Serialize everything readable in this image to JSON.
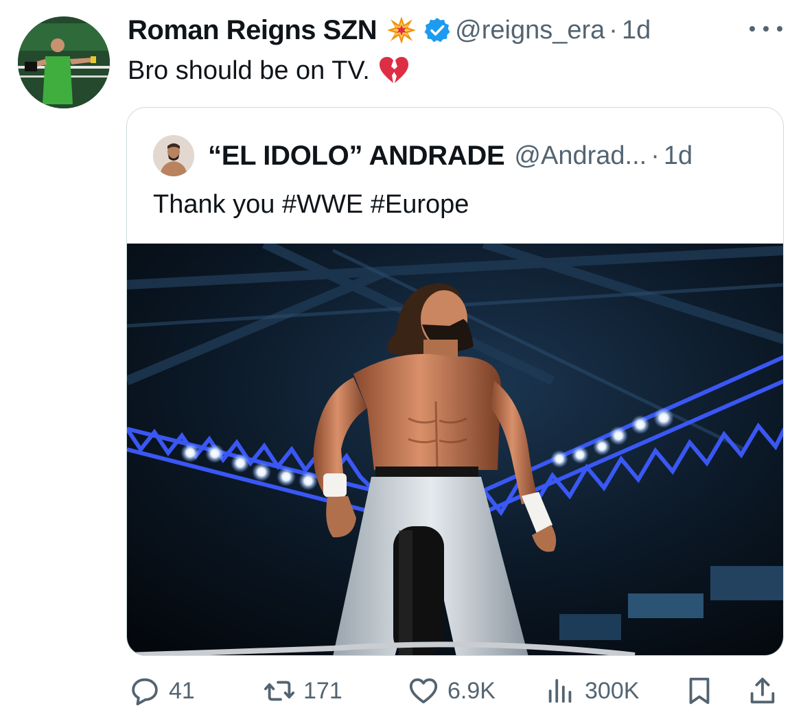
{
  "tweet": {
    "author_name": "Roman Reigns SZN",
    "author_handle": "@reigns_era",
    "separator": "·",
    "time": "1d",
    "text": "Bro should be on TV."
  },
  "quoted": {
    "author_name": "“EL IDOLO” ANDRADE",
    "author_handle": "@Andrad...",
    "separator": "·",
    "time": "1d",
    "text": "Thank you #WWE #Europe"
  },
  "stats": {
    "replies": "41",
    "reposts": "171",
    "likes": "6.9K",
    "views": "300K"
  },
  "icons": {
    "emoji_after_name": "collision-icon",
    "badge": "verified-icon",
    "emoji_after_text": "broken-heart-icon",
    "menu": "more-icon",
    "reply": "reply-icon",
    "repost": "repost-icon",
    "like": "heart-icon",
    "views": "views-icon",
    "bookmark": "bookmark-icon",
    "share": "share-icon"
  },
  "colors": {
    "text": "#0f1419",
    "secondary": "#536471",
    "verified": "#1d9bf0",
    "border": "#cfd9de"
  }
}
